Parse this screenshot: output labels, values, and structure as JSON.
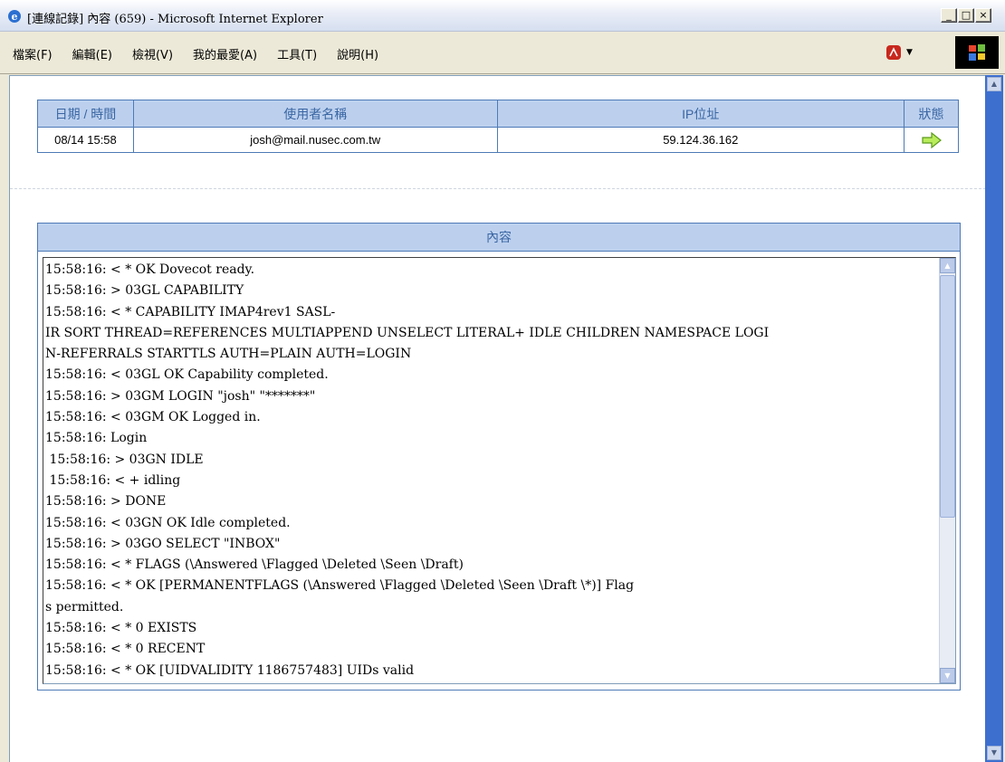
{
  "window": {
    "title": "[連線記錄] 內容 (659) - Microsoft Internet Explorer",
    "minimize_icon": "minimize-icon",
    "maximize_icon": "maximize-icon",
    "close_icon": "close-icon"
  },
  "menubar": {
    "items": [
      "檔案(F)",
      "編輯(E)",
      "檢視(V)",
      "我的最愛(A)",
      "工具(T)",
      "說明(H)"
    ]
  },
  "session": {
    "headers": [
      "日期 / 時間",
      "使用者名稱",
      "IP位址",
      "狀態"
    ],
    "row": {
      "datetime": "08/14 15:58",
      "username": "josh@mail.nusec.com.tw",
      "ip": "59.124.36.162",
      "status_icon": "green-arrow-right-icon"
    }
  },
  "content": {
    "header": "內容",
    "log_lines": [
      "15:58:16: < * OK Dovecot ready.",
      "15:58:16: > 03GL CAPABILITY",
      "15:58:16: < * CAPABILITY IMAP4rev1 SASL-",
      "IR SORT THREAD=REFERENCES MULTIAPPEND UNSELECT LITERAL+ IDLE CHILDREN NAMESPACE LOGI",
      "N-REFERRALS STARTTLS AUTH=PLAIN AUTH=LOGIN",
      "15:58:16: < 03GL OK Capability completed.",
      "15:58:16: > 03GM LOGIN \"josh\" \"*******\"",
      "15:58:16: < 03GM OK Logged in.",
      "15:58:16: Login",
      " 15:58:16: > 03GN IDLE",
      " 15:58:16: < + idling",
      "15:58:16: > DONE",
      "15:58:16: < 03GN OK Idle completed.",
      "15:58:16: > 03GO SELECT \"INBOX\"",
      "15:58:16: < * FLAGS (\\Answered \\Flagged \\Deleted \\Seen \\Draft)",
      "15:58:16: < * OK [PERMANENTFLAGS (\\Answered \\Flagged \\Deleted \\Seen \\Draft \\*)] Flag",
      "s permitted.",
      "15:58:16: < * 0 EXISTS",
      "15:58:16: < * 0 RECENT",
      "15:58:16: < * OK [UIDVALIDITY 1186757483] UIDs valid"
    ]
  },
  "colors": {
    "table_header_bg": "#bcd0ee",
    "table_border": "#4d7ab7",
    "header_text": "#3a66a3",
    "scrollbar": "#3d6fcf"
  }
}
